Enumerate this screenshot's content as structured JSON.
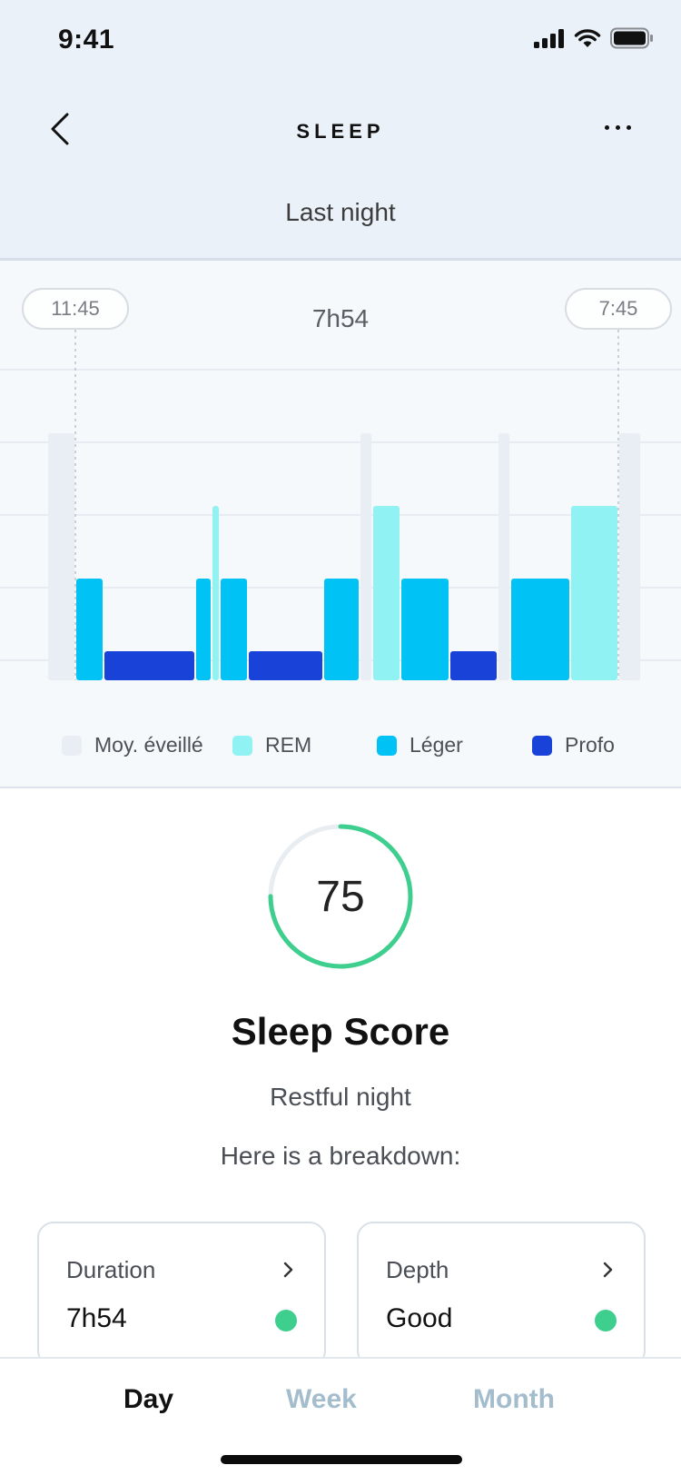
{
  "status_bar": {
    "time": "9:41"
  },
  "header": {
    "title": "SLEEP",
    "tab": "Last night"
  },
  "chart_data": {
    "type": "bar",
    "start_time": "11:45",
    "end_time": "7:45",
    "total_duration": "7h54",
    "legend": [
      {
        "name": "Moy. éveillé",
        "color": "#e8eef4"
      },
      {
        "name": "REM",
        "color": "#90f2f2"
      },
      {
        "name": "Léger",
        "color": "#00c2f5"
      },
      {
        "name": "Profo",
        "color": "#1842d8"
      }
    ],
    "stages_in_order": [
      "Moy. éveillé",
      "Léger",
      "Profo",
      "Léger",
      "REM",
      "Léger",
      "Profo",
      "Léger",
      "Moy. éveillé",
      "REM",
      "Léger",
      "Profo",
      "Moy. éveillé",
      "Léger",
      "REM",
      "Moy. éveillé"
    ]
  },
  "score": {
    "value": "75",
    "progress": 0.75,
    "title": "Sleep Score",
    "subtitle": "Restful night",
    "breakdown_label": "Here is a breakdown:",
    "ring_color": "#3ecf8e"
  },
  "cards": [
    {
      "title": "Duration",
      "value": "7h54"
    },
    {
      "title": "Depth",
      "value": "Good"
    }
  ],
  "tabbar": {
    "items": [
      {
        "label": "Day",
        "active": true
      },
      {
        "label": "Week",
        "active": false
      },
      {
        "label": "Month",
        "active": false
      }
    ]
  },
  "colors": {
    "active_tab": "#111111",
    "inactive_tab": "#a3bdcc",
    "header_bg": "#ebf1f8"
  }
}
